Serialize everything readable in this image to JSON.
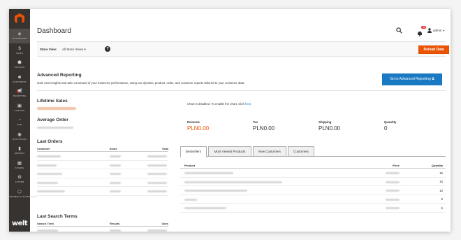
{
  "sidebar": {
    "items": [
      {
        "glyph": "◈",
        "label": "DASHBOARD",
        "active": true
      },
      {
        "glyph": "$",
        "label": "SALES"
      },
      {
        "glyph": "⬢",
        "label": "CATALOG"
      },
      {
        "glyph": "☻",
        "label": "CUSTOMERS"
      },
      {
        "glyph": "📢",
        "label": "MARKETING"
      },
      {
        "glyph": "▣",
        "label": "CONTENT"
      },
      {
        "glyph": "◔",
        "label": "B2B"
      },
      {
        "glyph": "◉",
        "label": "QUOTATIONS"
      },
      {
        "glyph": "▮",
        "label": "REPORTS"
      },
      {
        "glyph": "▦",
        "label": "STORES"
      },
      {
        "glyph": "⚙",
        "label": "SYSTEM"
      },
      {
        "glyph": "⬡",
        "label": "FIND PARTNERS & EXTENSIONS"
      }
    ],
    "brand": {
      "mark": "welt",
      "sub": ""
    }
  },
  "header": {
    "title": "Dashboard",
    "notifications_count": "38",
    "user_name": "admin"
  },
  "store_bar": {
    "label": "Store View:",
    "selected": "All Store Views",
    "reload_label": "Reload Data"
  },
  "advanced": {
    "title": "Advanced Reporting",
    "description": "Gain new insights and take command of your business' performance, using our dynamic product, order, and customer reports tailored to your customer data.",
    "button_label": "Go to Advanced Reporting"
  },
  "left": {
    "lifetime_title": "Lifetime Sales",
    "average_title": "Average Order",
    "last_orders_title": "Last Orders",
    "last_orders_cols": [
      "Customer",
      "Items",
      "Total"
    ],
    "last_orders_rows": 5,
    "search_title": "Last Search Terms",
    "search_cols": [
      "Search Term",
      "Results",
      "Uses"
    ]
  },
  "right": {
    "chart_disabled_text": "Chart is disabled. To enable the chart, click",
    "chart_link": "here.",
    "totals": [
      {
        "label": "Revenue",
        "value": "PLN0.00",
        "highlight": true
      },
      {
        "label": "Tax",
        "value": "PLN0.00"
      },
      {
        "label": "Shipping",
        "value": "PLN0.00"
      },
      {
        "label": "Quantity",
        "value": "0"
      }
    ],
    "tabs": [
      "Bestsellers",
      "Most Viewed Products",
      "New Customers",
      "Customers"
    ],
    "bestsellers_cols": [
      "Product",
      "Price",
      "Quantity"
    ],
    "bestsellers_quantities": [
      "15",
      "15",
      "10",
      "9",
      "5"
    ]
  },
  "colors": {
    "accent": "#eb5202",
    "primary": "#1979c3",
    "sidebar": "#373330"
  }
}
